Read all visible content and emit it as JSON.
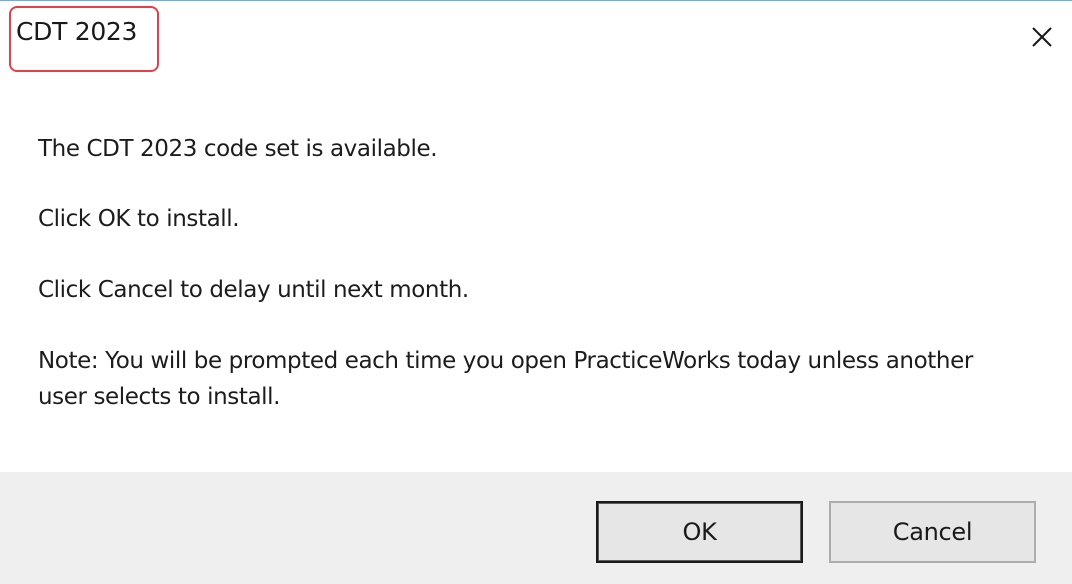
{
  "dialog": {
    "title": "CDT 2023",
    "close_icon": "close-icon",
    "messages": {
      "line1": "The CDT 2023 code set is available.",
      "line2": "Click OK to install.",
      "line3": "Click Cancel to delay until next month.",
      "line4": "Note: You will be prompted each time you open PracticeWorks today unless another user selects to install."
    },
    "buttons": {
      "ok_label": "OK",
      "cancel_label": "Cancel"
    },
    "colors": {
      "highlight": "#e5404a",
      "footer_bg": "#efefef",
      "button_bg": "#e6e6e6"
    }
  }
}
